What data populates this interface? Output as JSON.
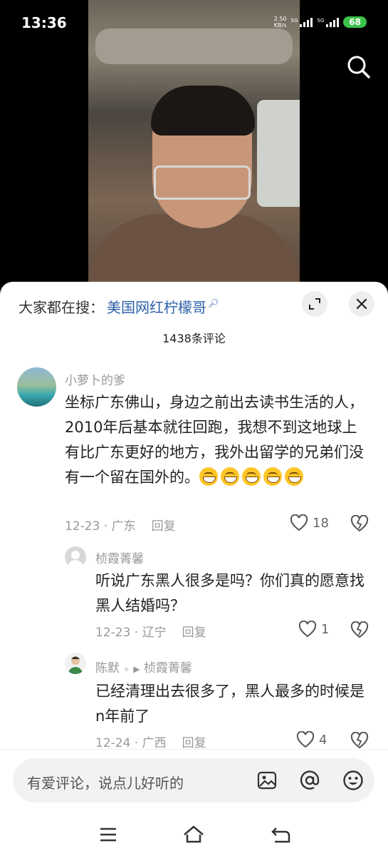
{
  "status": {
    "time": "13:36",
    "net_speed_value": "2.50",
    "net_speed_unit": "KB/s",
    "sim1_label": "5G",
    "sim2_label": "5G",
    "battery": "68"
  },
  "video": {
    "search_icon": "search-icon"
  },
  "sheet": {
    "hot_search_label": "大家都在搜：",
    "hot_search_keyword": "美国网红柠檬哥",
    "comment_count": "1438条评论"
  },
  "comments": [
    {
      "name": "小萝卜的爹",
      "text": "坐标广东佛山，身边之前出去读书生活的人，2010年后基本就往回跑，我想不到这地球上有比广东更好的地方，我外出留学的兄弟们没有一个留在国外的。",
      "emoji_count": 5,
      "date": "12-23",
      "location": "广东",
      "reply_label": "回复",
      "likes": "18"
    },
    {
      "name": "桢霞菁馨",
      "text": "听说广东黑人很多是吗？你们真的愿意找黑人结婚吗？",
      "date": "12-23",
      "location": "辽宁",
      "reply_label": "回复",
      "likes": "1"
    },
    {
      "name": "陈默",
      "reply_to": "桢霞菁馨",
      "text": "已经清理出去很多了，黑人最多的时候是n年前了",
      "date": "12-24",
      "location": "广西",
      "reply_label": "回复",
      "likes": "4"
    }
  ],
  "input": {
    "placeholder": "有爱评论，说点儿好听的"
  },
  "colors": {
    "keyword": "#2b5fa8",
    "battery": "#3cc24a"
  }
}
